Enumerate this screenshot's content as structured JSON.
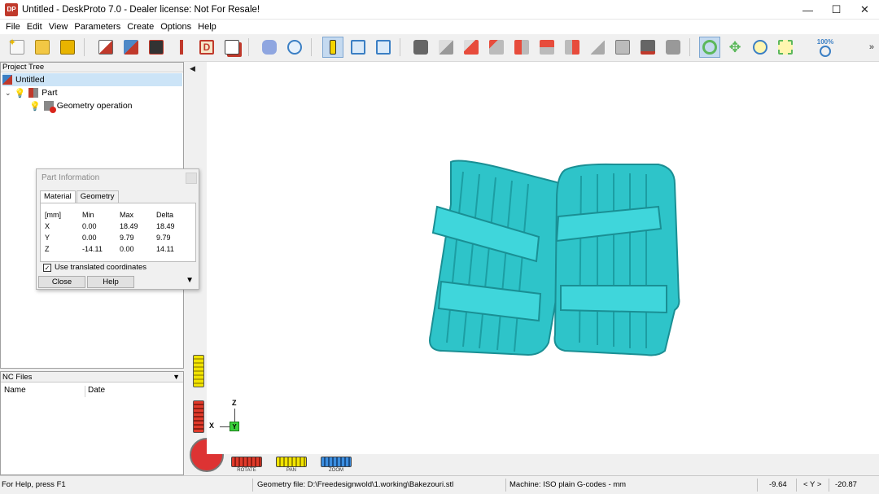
{
  "window": {
    "title": "Untitled - DeskProto 7.0 - Dealer license: Not For Resale!",
    "logo_text": "DP",
    "minimize": "—",
    "maximize": "☐",
    "close": "✕"
  },
  "menu": [
    "File",
    "Edit",
    "View",
    "Parameters",
    "Create",
    "Options",
    "Help"
  ],
  "toolbar": {
    "zoom_label": "100%",
    "overflow": "»"
  },
  "project_tree": {
    "header": "Project Tree",
    "root": "Untitled",
    "part": "Part",
    "operation": "Geometry operation"
  },
  "nc_files": {
    "header": "NC Files",
    "columns": [
      "Name",
      "Date"
    ]
  },
  "part_info": {
    "title": "Part Information",
    "tabs": [
      "Material",
      "Geometry"
    ],
    "headers": [
      "[mm]",
      "Min",
      "Max",
      "Delta"
    ],
    "rows": [
      [
        "X",
        "0.00",
        "18.49",
        "18.49"
      ],
      [
        "Y",
        "0.00",
        "9.79",
        "9.79"
      ],
      [
        "Z",
        "-14.11",
        "0.00",
        "14.11"
      ]
    ],
    "checkbox_label": "Use translated coordinates",
    "checkbox_checked": true,
    "close_btn": "Close",
    "help_btn": "Help"
  },
  "view_controls": {
    "rotate": "ROTATE",
    "pan": "PAN",
    "zoom": "ZOOM",
    "axis_z": "Z",
    "axis_x": "X",
    "axis_y": "Y"
  },
  "statusbar": {
    "help": "For Help, press F1",
    "geometry_file": "Geometry file: D:\\Freedesignwold\\1.working\\Bakezouri.stl",
    "machine": "Machine: ISO plain G-codes - mm",
    "coord_x": "-9.64",
    "axis_label": "< Y >",
    "coord_y": "-20.87"
  },
  "colors": {
    "model": "#2ec4c9",
    "model_shadow": "#1a8f94",
    "selection": "#cce4f7"
  }
}
